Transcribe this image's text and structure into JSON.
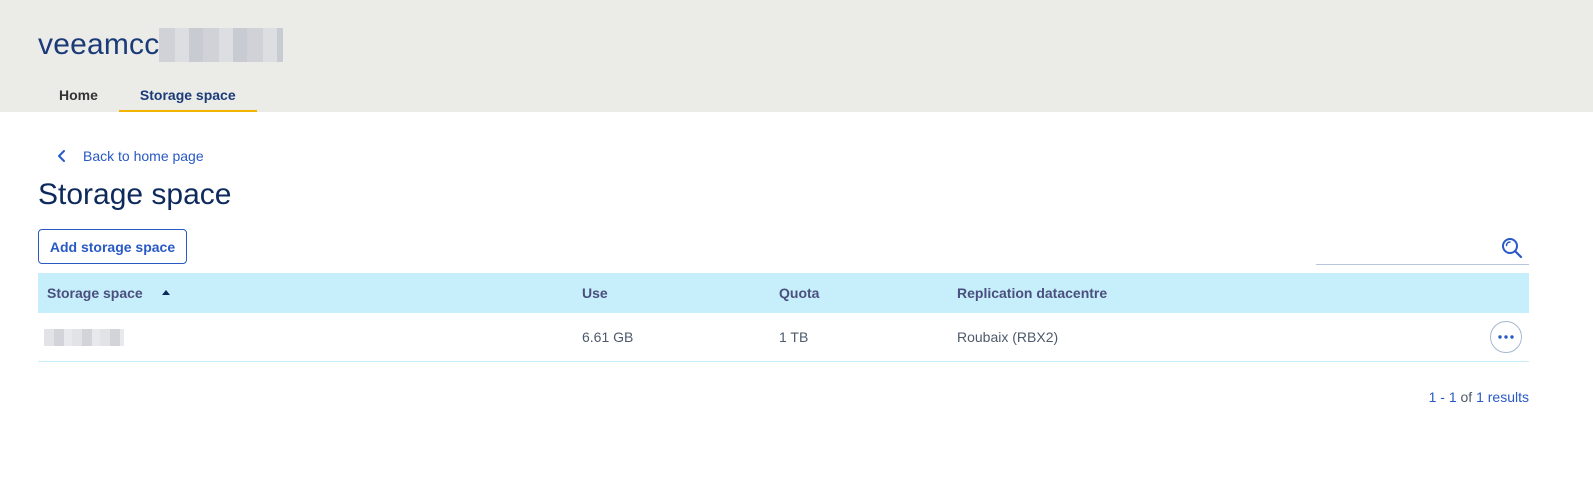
{
  "header": {
    "app_title": "veeamcc",
    "tabs": [
      {
        "label": "Home",
        "active": false
      },
      {
        "label": "Storage space",
        "active": true
      }
    ],
    "accent_color": "#f3b400"
  },
  "navigation": {
    "back_link": "Back to home page"
  },
  "page": {
    "title": "Storage space",
    "add_button": "Add storage space",
    "search_placeholder": ""
  },
  "table": {
    "columns": [
      "Storage space",
      "Use",
      "Quota",
      "Replication datacentre"
    ],
    "sort": {
      "column": "Storage space",
      "direction": "ascending"
    },
    "rows": [
      {
        "name": "",
        "use": "6.61 GB",
        "quota": "1 TB",
        "datacentre": "Roubaix (RBX2)"
      }
    ]
  },
  "pagination": {
    "range": "1 - 1",
    "of_label": "of",
    "total": "1",
    "results_label": "results"
  },
  "icons": {
    "back": "chevron-left-icon",
    "search": "search-icon",
    "sort": "sort-ascending-icon",
    "more": "more-horizontal-icon"
  }
}
